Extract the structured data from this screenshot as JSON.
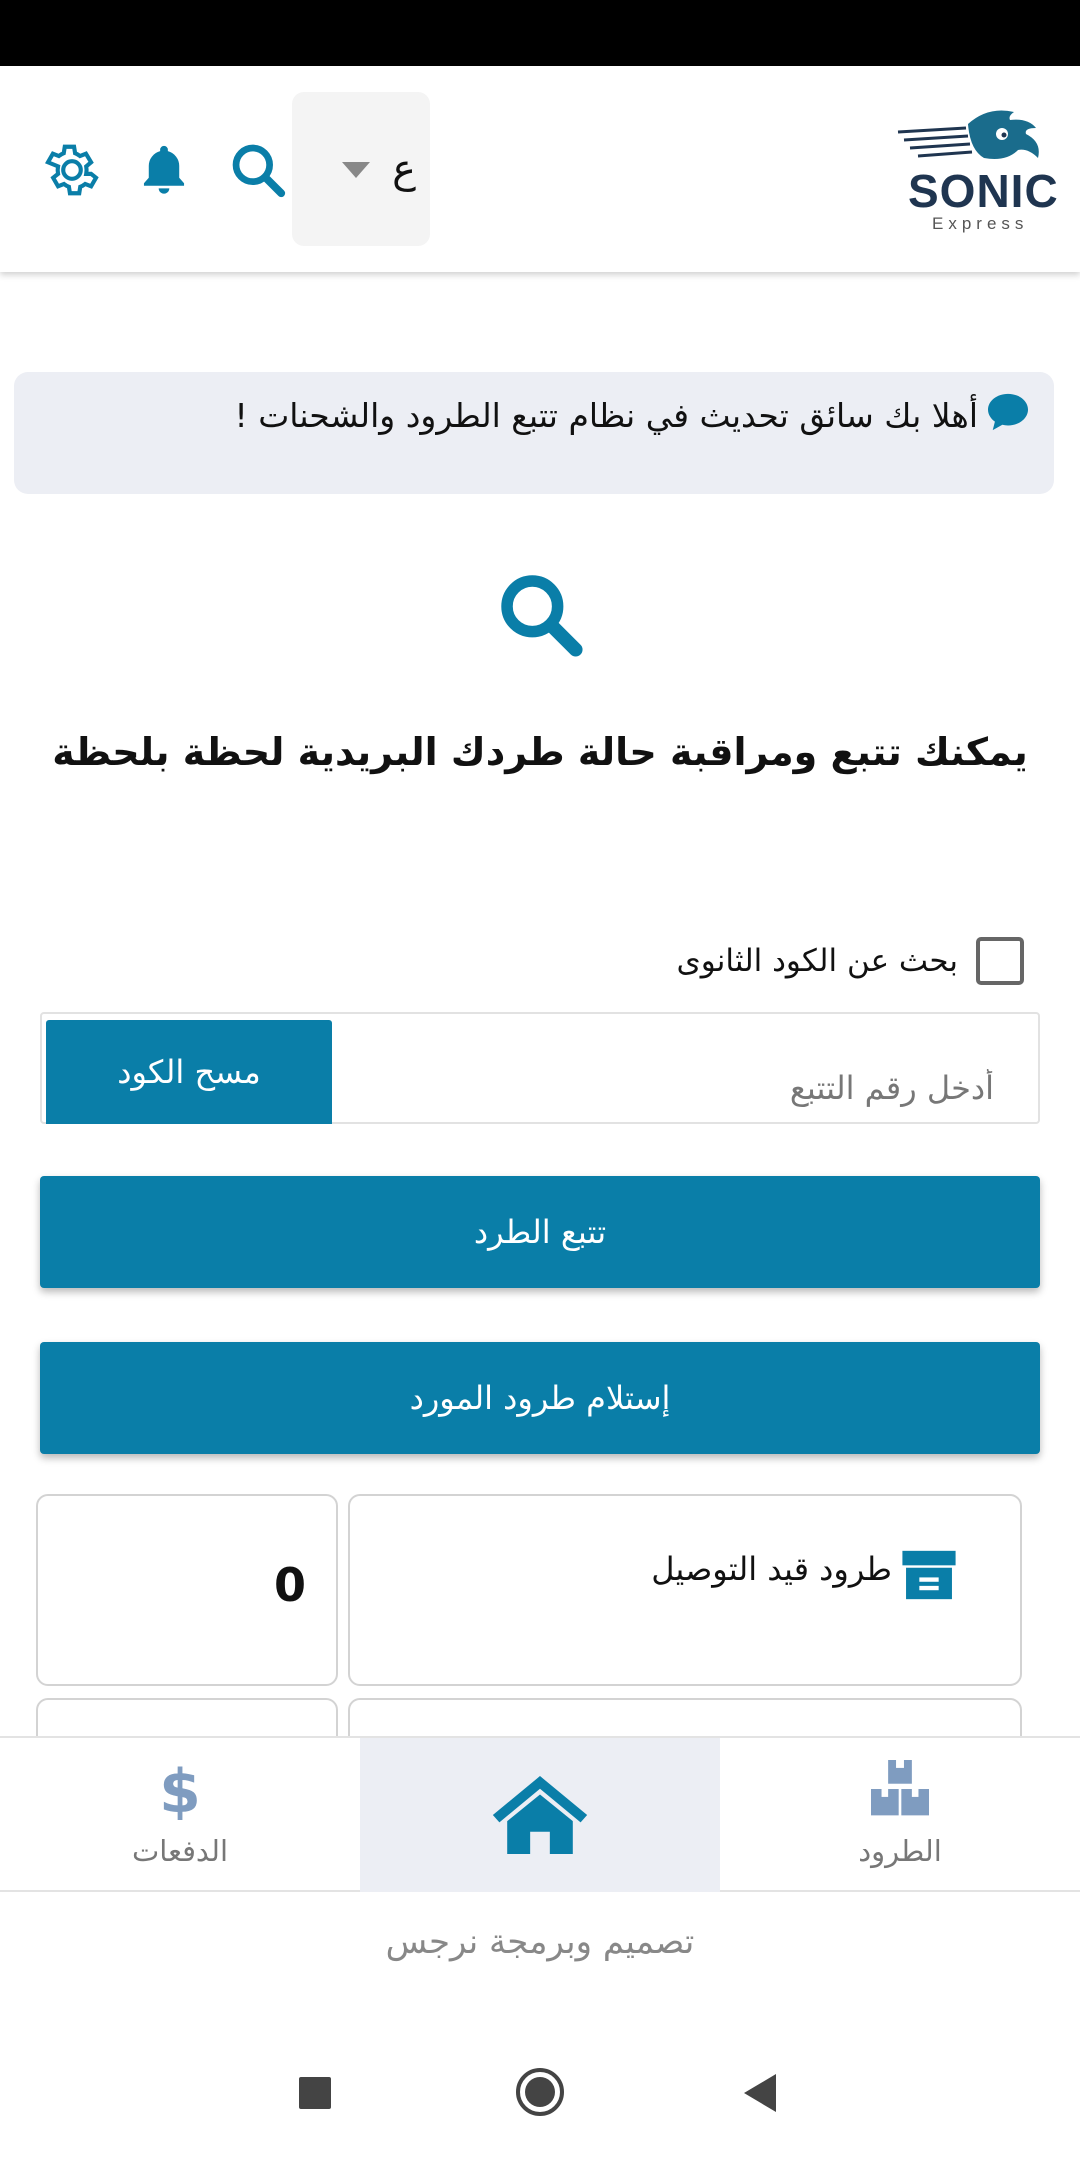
{
  "header": {
    "language_value": "ع",
    "logo_text": "SONIC",
    "logo_subtext": "Express"
  },
  "welcome_message": "أهلا بك سائق تحديث في نظام تتبع الطرود والشحنات !",
  "tagline": "يمكنك تتبع ومراقبة حالة طردك البريدية لحظة بلحظة",
  "search": {
    "secondary_code_label": "بحث عن الكود الثانوى",
    "secondary_code_checked": false,
    "tracking_placeholder": "أدخل رقم التتبع",
    "scan_button_label": "مسح الكود"
  },
  "buttons": {
    "track_parcel": "تتبع الطرد",
    "receive_supplier_parcels": "إستلام طرود المورد"
  },
  "stats": [
    {
      "title": "طرود قيد التوصيل",
      "count": "0"
    }
  ],
  "bottom_nav": {
    "items": [
      {
        "label": "الدفعات",
        "icon": "dollar-icon"
      },
      {
        "label": "",
        "icon": "home-icon",
        "active": true
      },
      {
        "label": "الطرود",
        "icon": "boxes-icon"
      }
    ]
  },
  "credits": "تصميم وبرمجة نرجس",
  "colors": {
    "primary": "#0a7ea8",
    "welcome_bg": "#eceef4",
    "nav_icon": "#7f9cc0"
  }
}
